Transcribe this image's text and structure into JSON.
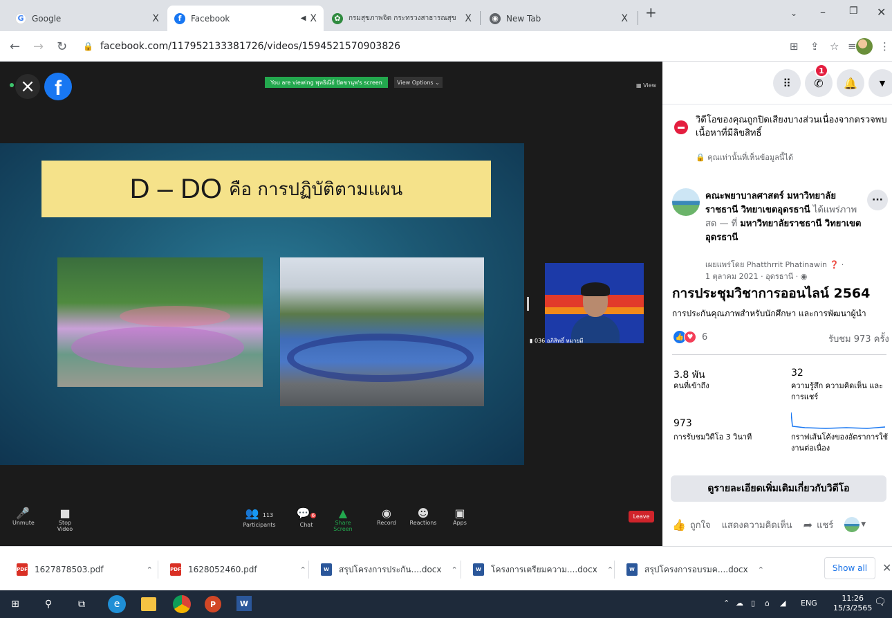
{
  "browser": {
    "tabs": [
      {
        "label": "Google",
        "close": "X"
      },
      {
        "label": "Facebook",
        "close": "X"
      },
      {
        "label": "กรมสุขภาพจิต กระทรวงสาธารณสุข",
        "close": "X"
      },
      {
        "label": "New Tab",
        "close": "X"
      }
    ],
    "new_tab": "+",
    "url": "facebook.com/117952133381726/videos/1594521570903826"
  },
  "zoom": {
    "share_banner": "You are viewing พุทธิณีย์ ปัดขานุพ's screen",
    "view_options": "View Options ⌄",
    "view_right": "View",
    "participant_count": "113",
    "chat_badge": "6",
    "cam_name": "036 อภิสิทธิ์ หมายมี",
    "controls": [
      {
        "icon": "🎤",
        "label": "Unmute"
      },
      {
        "icon": "■",
        "label": "Stop Video"
      },
      {
        "icon": "👥",
        "label": "Participants"
      },
      {
        "icon": "💬",
        "label": "Chat"
      },
      {
        "icon": "▲",
        "label": "Share Screen"
      },
      {
        "icon": "◉",
        "label": "Record"
      },
      {
        "icon": "☻",
        "label": "Reactions"
      },
      {
        "icon": "▣",
        "label": "Apps"
      }
    ],
    "leave": "Leave"
  },
  "slide": {
    "title_big": "D – DO",
    "title_small": "คือ การปฏิบัติตามแผน"
  },
  "panel": {
    "messenger_badge": "1",
    "notice": "วิดีโอของคุณถูกปิดเสียงบางส่วนเนื่องจากตรวจพบเนื้อหาที่มีลิขสิทธิ์",
    "notice_sub": "คุณเท่านั้นที่เห็นข้อมูลนี้ได้",
    "page_name": "คณะพยาบาลศาสตร์ มหาวิทยาลัยราชธานี วิทยาเขตอุดรธานี",
    "shared_live": "ได้แพร่ภาพสด — ที่",
    "location": "มหาวิทยาลัยราชธานี วิทยาเขตอุดรธานี",
    "published_by": "เผยแพร่โดย Phatthrrit Phatinawin",
    "date_place": "1 ตุลาคม 2021 · อุดรธานี ·",
    "title": "การประชุมวิชาการออนไลน์ 2564",
    "desc": "การประกันคุณภาพสำหรับนักศึกษา และการพัฒนาผู้นำ",
    "reaction_count": "6",
    "views": "รับชม 973 ครั้ง",
    "stats": [
      {
        "value": "3.8 พัน",
        "label": "คนที่เข้าถึง"
      },
      {
        "value": "32",
        "label": "ความรู้สึก ความคิดเห็น และการแชร์"
      },
      {
        "value": "973",
        "label": "การรับชมวิดีโอ 3 วินาที"
      },
      {
        "value": "",
        "label": "กราฟเส้นโค้งของอัตราการใช้งานต่อเนื่อง"
      }
    ],
    "more_details": "ดูรายละเอียดเพิ่มเติมเกี่ยวกับวิดีโอ",
    "like": "ถูกใจ",
    "comment": "แสดงความคิดเห็น",
    "share": "แชร์"
  },
  "downloads": {
    "items": [
      {
        "name": "1627878503.pdf",
        "type": "pdf"
      },
      {
        "name": "1628052460.pdf",
        "type": "pdf"
      },
      {
        "name": "สรุปโครงการประกัน....docx",
        "type": "docx"
      },
      {
        "name": "โครงการเตรียมความ....docx",
        "type": "docx"
      },
      {
        "name": "สรุปโครงการอบรมค....docx",
        "type": "docx"
      }
    ],
    "show_all": "Show all"
  },
  "taskbar": {
    "lang": "ENG",
    "time": "11:26",
    "date": "15/3/2565"
  }
}
